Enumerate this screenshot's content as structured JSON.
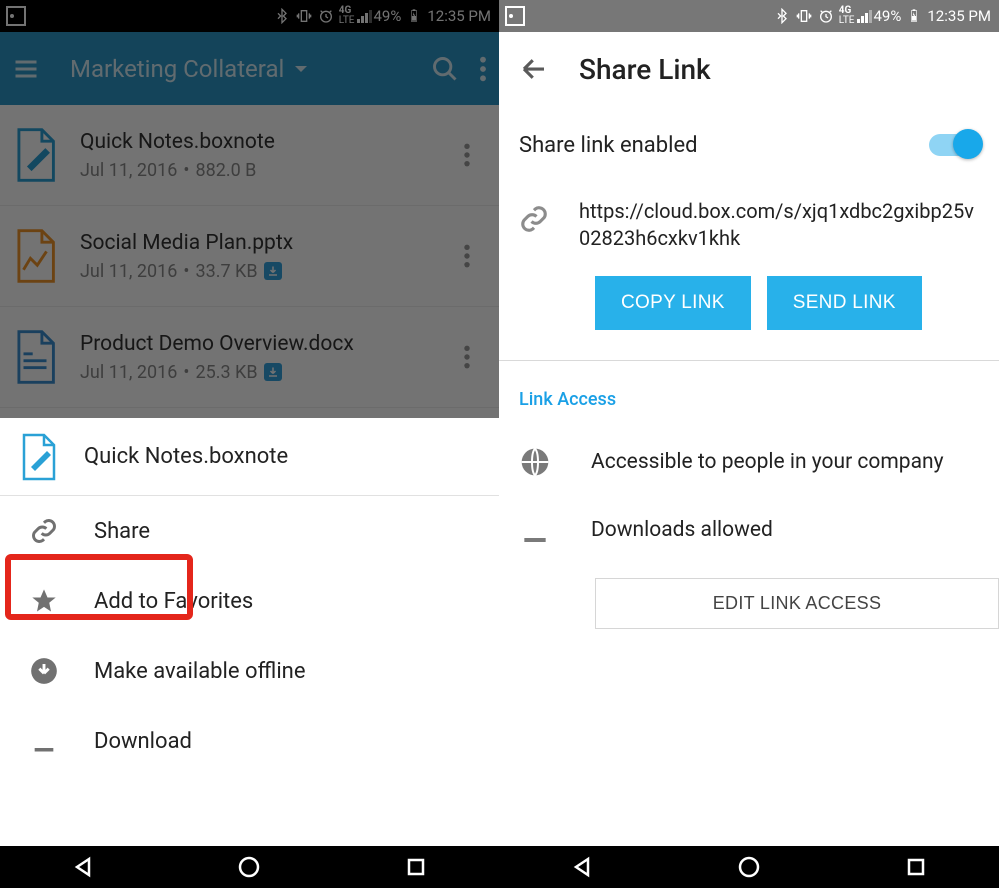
{
  "status": {
    "time": "12:35 PM",
    "battery_pct": "49%",
    "network": "4G",
    "carrier_label": "LTE"
  },
  "left": {
    "toolbar": {
      "title": "Marketing Collateral"
    },
    "files": [
      {
        "name": "Quick Notes.boxnote",
        "date": "Jul 11, 2016",
        "size": "882.0 B",
        "downloaded": false,
        "icon": "boxnote"
      },
      {
        "name": "Social Media Plan.pptx",
        "date": "Jul 11, 2016",
        "size": "33.7 KB",
        "downloaded": true,
        "icon": "pptx"
      },
      {
        "name": "Product Demo Overview.docx",
        "date": "Jul 11, 2016",
        "size": "25.3 KB",
        "downloaded": true,
        "icon": "docx"
      }
    ],
    "sheet": {
      "header_filename": "Quick Notes.boxnote",
      "items": [
        {
          "icon": "link",
          "label": "Share"
        },
        {
          "icon": "star",
          "label": "Add to Favorites"
        },
        {
          "icon": "offline",
          "label": "Make available offline"
        },
        {
          "icon": "download",
          "label": "Download"
        }
      ]
    }
  },
  "right": {
    "title": "Share Link",
    "enabled_label": "Share link enabled",
    "enabled": true,
    "url": "https://cloud.box.com/s/xjq1xdbc2gxibp25v02823h6cxkv1khk",
    "copy_label": "COPY LINK",
    "send_label": "SEND LINK",
    "section_label": "Link Access",
    "access": [
      {
        "icon": "globe",
        "label": "Accessible to people in your company"
      },
      {
        "icon": "download",
        "label": "Downloads allowed"
      }
    ],
    "edit_label": "EDIT LINK ACCESS"
  }
}
